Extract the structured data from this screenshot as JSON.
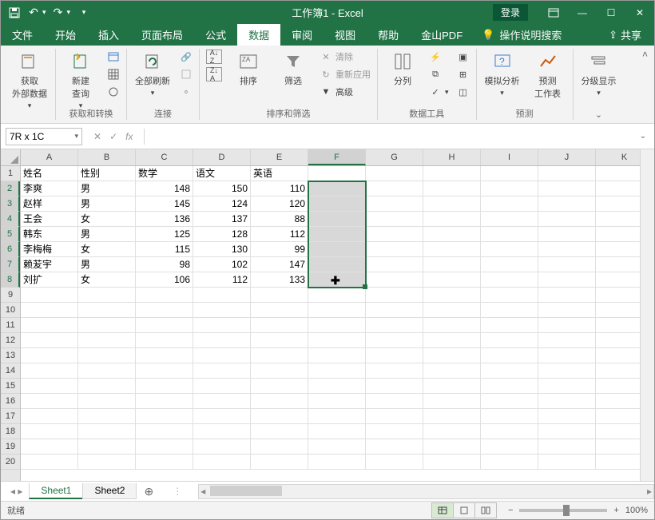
{
  "title": "工作簿1 - Excel",
  "login": "登录",
  "tabs": [
    "文件",
    "开始",
    "插入",
    "页面布局",
    "公式",
    "数据",
    "审阅",
    "视图",
    "帮助",
    "金山PDF"
  ],
  "active_tab": 5,
  "tell_me": "操作说明搜索",
  "share": "共享",
  "ribbon": {
    "get_external": "获取\n外部数据",
    "new_query": "新建\n查询",
    "get_transform": "获取和转换",
    "refresh_all": "全部刷新",
    "connections": "连接",
    "sort": "排序",
    "filter": "筛选",
    "clear": "清除",
    "reapply": "重新应用",
    "advanced": "高级",
    "sort_filter": "排序和筛选",
    "text_to_cols": "分列",
    "data_tools": "数据工具",
    "whatif": "模拟分析",
    "forecast": "预测\n工作表",
    "forecast_group": "预测",
    "outline": "分级显示"
  },
  "name_box": "7R x 1C",
  "formula": "",
  "col_letters": [
    "A",
    "B",
    "C",
    "D",
    "E",
    "F",
    "G",
    "H",
    "I",
    "J",
    "K"
  ],
  "sel_col_idx": 5,
  "sel_row_start": 2,
  "sel_row_end": 8,
  "headers": [
    "姓名",
    "性别",
    "数学",
    "语文",
    "英语"
  ],
  "rows": [
    {
      "name": "李爽",
      "gender": "男",
      "math": 148,
      "chinese": 150,
      "english": 110
    },
    {
      "name": "赵样",
      "gender": "男",
      "math": 145,
      "chinese": 124,
      "english": 120
    },
    {
      "name": "王会",
      "gender": "女",
      "math": 136,
      "chinese": 137,
      "english": 88
    },
    {
      "name": "韩东",
      "gender": "男",
      "math": 125,
      "chinese": 128,
      "english": 112
    },
    {
      "name": "李梅梅",
      "gender": "女",
      "math": 115,
      "chinese": 130,
      "english": 99
    },
    {
      "name": "赖苃宇",
      "gender": "男",
      "math": 98,
      "chinese": 102,
      "english": 147
    },
    {
      "name": "刘扩",
      "gender": "女",
      "math": 106,
      "chinese": 112,
      "english": 133
    }
  ],
  "sheets": [
    "Sheet1",
    "Sheet2"
  ],
  "active_sheet": 0,
  "status": "就绪",
  "zoom": "100%"
}
